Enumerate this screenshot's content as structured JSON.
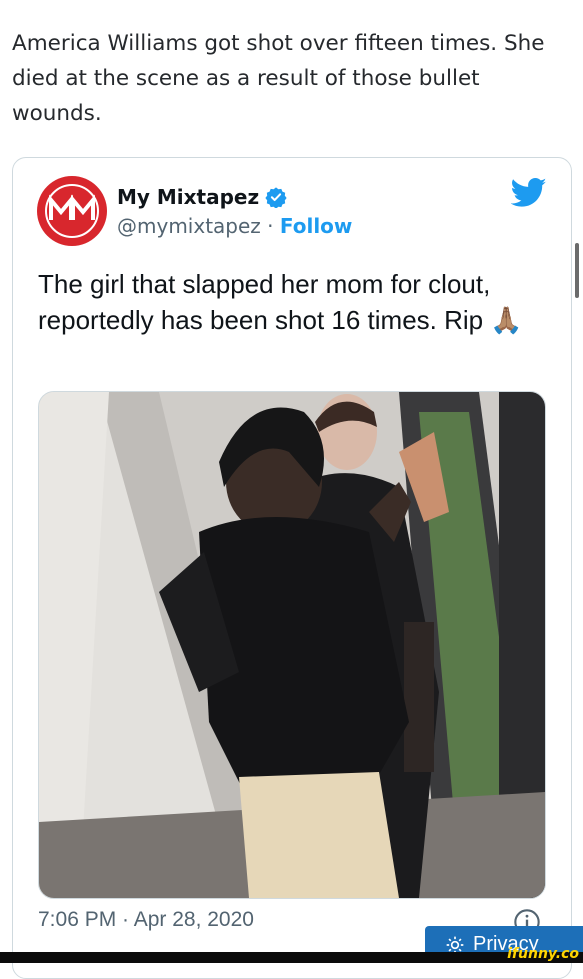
{
  "caption": "America Williams got shot over fifteen times. She died at the scene as a result of those bullet wounds.",
  "tweet": {
    "author_name": "My Mixtapez",
    "handle": "@mymixtapez",
    "separator": " · ",
    "follow_label": "Follow",
    "avatar_text": "MM",
    "text": "The girl that slapped her mom for clout, reportedly has been shot 16 times. Rip",
    "emoji": "🙏🏽",
    "timestamp": "7:06 PM · Apr 28, 2020"
  },
  "overlay": {
    "privacy_label": "Privacy",
    "watermark": "ifunny.co"
  },
  "colors": {
    "brand_blue": "#1d9bf0",
    "avatar_red": "#d8272d",
    "secondary_text": "#536471"
  },
  "icons": [
    "verified-badge-icon",
    "twitter-bird-icon",
    "info-icon",
    "privacy-gear-icon"
  ]
}
